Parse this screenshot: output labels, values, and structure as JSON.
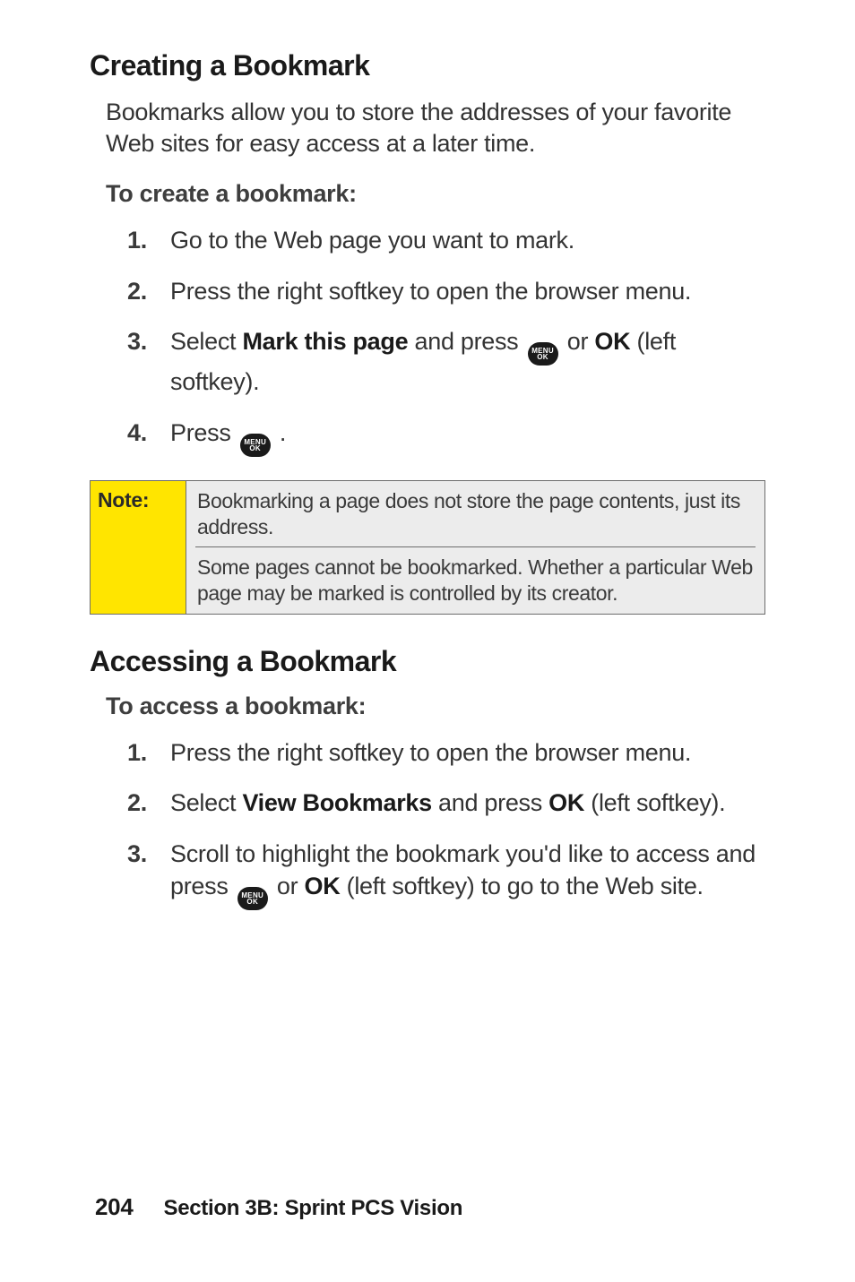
{
  "section1": {
    "heading": "Creating a Bookmark",
    "intro": "Bookmarks allow you to store the addresses of your favorite Web sites for easy access at a later time.",
    "lead": "To create a bookmark:",
    "steps": [
      {
        "num": "1.",
        "text_plain": "Go to the Web page you want to mark."
      },
      {
        "num": "2.",
        "text_plain": "Press the right softkey to open the browser menu."
      },
      {
        "num": "3.",
        "prefix": "Select ",
        "bold1": "Mark this page",
        "mid1": " and press ",
        "icon_label": "MENU\nOK",
        "mid2": " or ",
        "bold2": "OK",
        "suffix": " (left softkey)."
      },
      {
        "num": "4.",
        "prefix": "Press ",
        "icon_label": "MENU\nOK",
        "suffix": " ."
      }
    ]
  },
  "note": {
    "label": "Note:",
    "line1": "Bookmarking a page does not store the page contents, just its address.",
    "line2": "Some pages cannot be bookmarked. Whether a particular Web page may be marked is controlled by its creator."
  },
  "section2": {
    "heading": "Accessing a Bookmark",
    "lead": "To access a bookmark:",
    "steps": [
      {
        "num": "1.",
        "text_plain": "Press the right softkey to open the browser menu."
      },
      {
        "num": "2.",
        "prefix": "Select ",
        "bold1": "View Bookmarks",
        "mid1": " and press ",
        "bold2": "OK",
        "suffix": " (left softkey)."
      },
      {
        "num": "3.",
        "prefix": "Scroll to highlight the bookmark you'd like to access and press ",
        "icon_label": "MENU\nOK",
        "mid2": " or ",
        "bold2": "OK",
        "suffix": " (left softkey) to go to the Web site."
      }
    ]
  },
  "footer": {
    "page": "204",
    "section": "Section 3B: Sprint PCS Vision"
  },
  "icon": {
    "menu": "MENU",
    "ok": "OK"
  }
}
